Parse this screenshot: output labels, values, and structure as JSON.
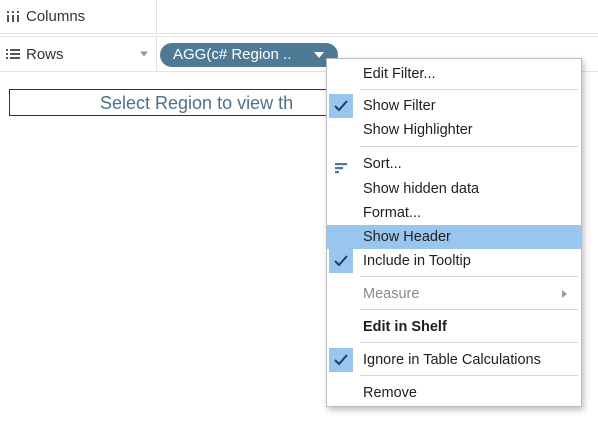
{
  "shelves": {
    "columns_label": "Columns",
    "rows_label": "Rows"
  },
  "pill": {
    "label": "AGG(c# Region .."
  },
  "view": {
    "title_text": "Select Region to view th"
  },
  "menu": {
    "items": [
      {
        "label": "Edit Filter..."
      },
      {
        "label": "Show Filter",
        "checked": true
      },
      {
        "label": "Show Highlighter"
      },
      {
        "label": "Sort..."
      },
      {
        "label": "Show hidden data"
      },
      {
        "label": "Format..."
      },
      {
        "label": "Show Header",
        "highlighted": true
      },
      {
        "label": "Include in Tooltip",
        "checked": true
      },
      {
        "label": "Measure",
        "disabled": true,
        "submenu": true
      },
      {
        "label": "Edit in Shelf",
        "bold": true
      },
      {
        "label": "Ignore in Table Calculations",
        "checked": true
      },
      {
        "label": "Remove"
      }
    ]
  },
  "colors": {
    "pill": "#4f7a95",
    "highlight": "#99c6ee",
    "title_text": "#4f6f87",
    "check": "#1f3f66"
  },
  "icons": {
    "columns": "columns-icon",
    "rows": "rows-icon",
    "check": "check-icon",
    "sort": "sort-icon",
    "submenu": "chevron-right-icon"
  }
}
